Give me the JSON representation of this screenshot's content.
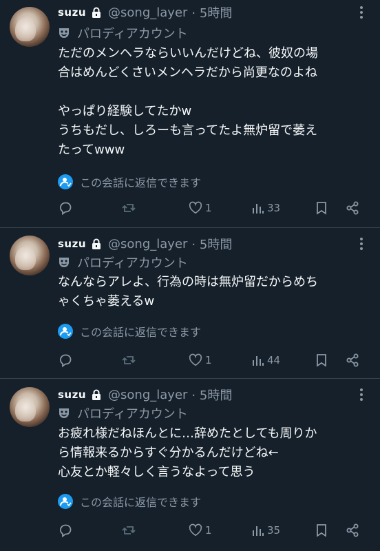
{
  "colors": {
    "background": "#15202b",
    "text": "#f7f9f9",
    "muted": "#8b98a5",
    "accent": "#1d9bf0",
    "divider": "#38444d"
  },
  "icons": [
    "lock-icon",
    "more-icon",
    "parody-mask-icon",
    "reply-restricted-icon",
    "reply-icon",
    "retweet-icon",
    "like-icon",
    "views-icon",
    "bookmark-icon",
    "share-icon"
  ],
  "tweets": [
    {
      "name": "suzu",
      "handle": "@song_layer",
      "time": "· 5時間",
      "parody_label": "パロディアカウント",
      "lines": [
        "ただのメンヘラならいいんだけどね、彼奴の場",
        "合はめんどくさいメンヘラだから尚更なのよね",
        "",
        "やっぱり経験してたかw",
        "うちもだし、しろーも言ってたよ無炉留で萎え",
        "たってwww"
      ],
      "reply_note": "この会話に返信できます",
      "likes": "1",
      "views": "33"
    },
    {
      "name": "suzu",
      "handle": "@song_layer",
      "time": "· 5時間",
      "parody_label": "パロディアカウント",
      "lines": [
        "なんならアレよ、行為の時は無炉留だからめち",
        "ゃくちゃ萎えるw"
      ],
      "reply_note": "この会話に返信できます",
      "likes": "1",
      "views": "44"
    },
    {
      "name": "suzu",
      "handle": "@song_layer",
      "time": "· 5時間",
      "parody_label": "パロディアカウント",
      "lines": [
        "お疲れ様だねほんとに…辞めたとしても周りか",
        "ら情報来るからすぐ分かるんだけどね←",
        "心友とか軽々しく言うなよって思う"
      ],
      "reply_note": "この会話に返信できます",
      "likes": "1",
      "views": "35"
    }
  ]
}
